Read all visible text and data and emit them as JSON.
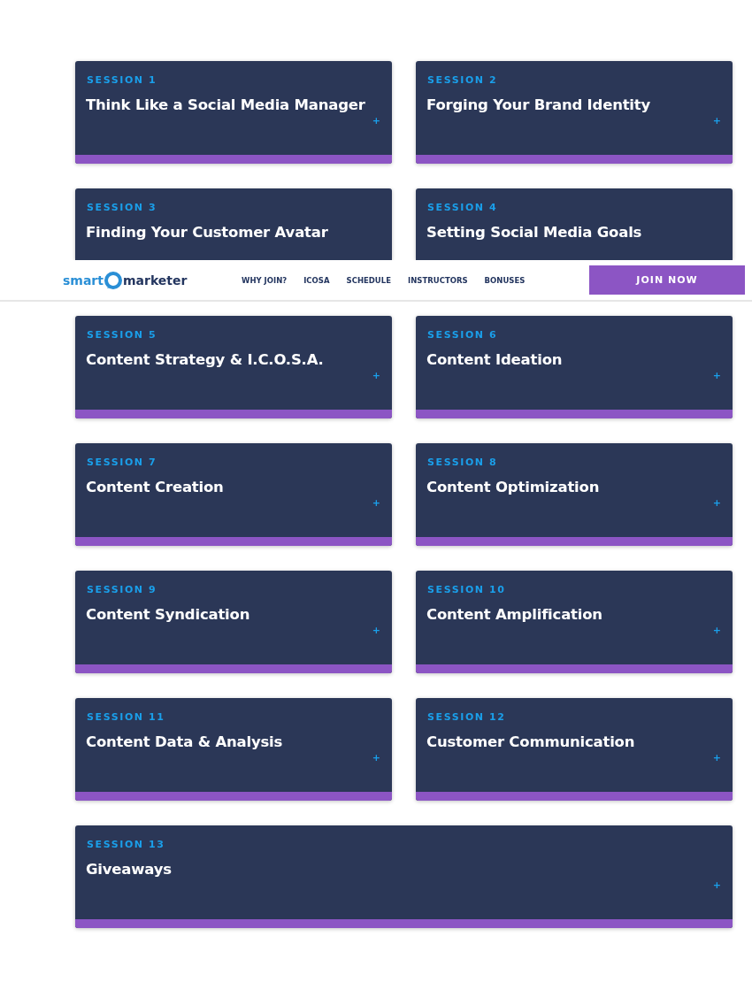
{
  "sessions": [
    {
      "label": "SESSION 1",
      "title": "Think Like a Social Media Manager",
      "expand": "+",
      "wide": false
    },
    {
      "label": "SESSION 2",
      "title": "Forging Your Brand Identity",
      "expand": "+",
      "wide": false
    },
    {
      "label": "SESSION 3",
      "title": "Finding Your Customer Avatar",
      "wide": false
    },
    {
      "label": "SESSION 4",
      "title": "Setting Social Media Goals",
      "wide": false
    },
    {
      "label": "SESSION 5",
      "title": "Content Strategy & I.C.O.S.A.",
      "expand": "+",
      "wide": false
    },
    {
      "label": "SESSION 6",
      "title": "Content Ideation",
      "expand": "+",
      "wide": false
    },
    {
      "label": "SESSION 7",
      "title": "Content Creation",
      "expand": "+",
      "wide": false
    },
    {
      "label": "SESSION 8",
      "title": "Content Optimization",
      "expand": "+",
      "wide": false
    },
    {
      "label": "SESSION 9",
      "title": "Content Syndication",
      "expand": "+",
      "wide": false
    },
    {
      "label": "SESSION 10",
      "title": "Content Amplification",
      "expand": "+",
      "wide": false
    },
    {
      "label": "SESSION 11",
      "title": "Content Data & Analysis",
      "expand": "+",
      "wide": false
    },
    {
      "label": "SESSION 12",
      "title": "Customer Communication",
      "expand": "+",
      "wide": false
    },
    {
      "label": "SESSION 13",
      "title": "Giveaways",
      "expand": "+",
      "wide": true
    }
  ],
  "header": {
    "logo": {
      "part_1": "smart",
      "part_2": "marketer"
    },
    "nav": [
      "WHY JOIN?",
      "ICOSA",
      "SCHEDULE",
      "INSTRUCTORS",
      "BONUSES"
    ],
    "cta": "JOIN NOW"
  }
}
